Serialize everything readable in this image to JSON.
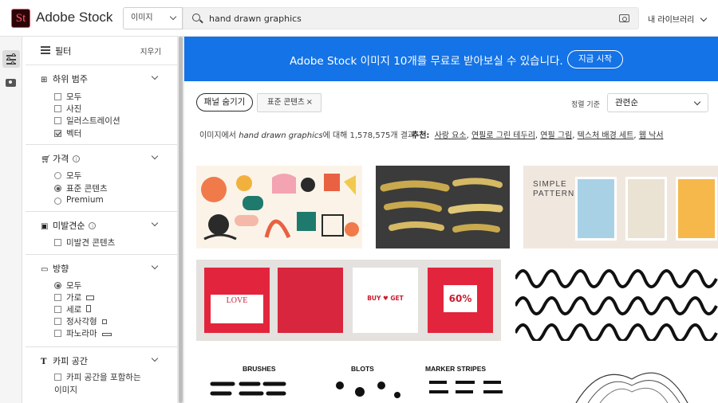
{
  "header": {
    "logo_mark": "St",
    "logo_text": "Adobe Stock",
    "asset_type": "이미지",
    "search_value": "hand drawn graphics",
    "library_label": "내 라이브러리"
  },
  "filters": {
    "title": "필터",
    "clear": "지우기",
    "sections": {
      "category": {
        "title": "하위 범주",
        "options": [
          {
            "label": "모두",
            "checked": false
          },
          {
            "label": "사진",
            "checked": false
          },
          {
            "label": "일러스트레이션",
            "checked": false
          },
          {
            "label": "벡터",
            "checked": true
          }
        ]
      },
      "price": {
        "title": "가격",
        "options": [
          {
            "label": "모두",
            "selected": false
          },
          {
            "label": "표준 콘텐츠",
            "selected": true
          },
          {
            "label": "Premium",
            "selected": false
          }
        ]
      },
      "undiscovered": {
        "title": "미발견순",
        "options": [
          {
            "label": "미발견 콘텐츠",
            "checked": false
          }
        ]
      },
      "orientation": {
        "title": "방향",
        "options": [
          {
            "label": "모두",
            "selected": true
          },
          {
            "label": "가로",
            "checked": false
          },
          {
            "label": "세로",
            "checked": false
          },
          {
            "label": "정사각형",
            "checked": false
          },
          {
            "label": "파노라마",
            "checked": false
          }
        ]
      },
      "copy_space": {
        "title": "카피 공간",
        "option_line1": "카피 공간을 포함하는",
        "option_line2": "이미지"
      }
    }
  },
  "banner": {
    "text": "Adobe Stock 이미지 10개를 무료로 받아보실 수 있습니다.",
    "cta": "지금 시작"
  },
  "toolbar": {
    "hide_panel": "패널 숨기기",
    "chip_label": "표준 콘텐츠",
    "chip_close": "×",
    "sort_label": "정렬 기준",
    "sort_value": "관련순"
  },
  "results": {
    "prefix": "이미지에서 ",
    "query": "hand drawn graphics",
    "suffix": "에 대해 1,578,575개 결과",
    "suggest_label": "추천:",
    "suggestions": [
      "사랑 요소",
      "연필로 그린 테두리",
      "연필 그림",
      "텍스처 배경 세트",
      "웹 낙서"
    ]
  },
  "thumbnails": {
    "t3_line1": "SIMPLE",
    "t3_line2": "PATTERN",
    "t4_card1": "LOVE",
    "t4_card3": "BUY ♥ GET",
    "t4_card4": "60%",
    "t6_col1": "BRUSHES",
    "t6_col2": "BLOTS",
    "t6_col3": "MARKER STRIPES"
  },
  "colors": {
    "banner_blue": "#1473e6",
    "logo_red": "#ff5a6b"
  }
}
